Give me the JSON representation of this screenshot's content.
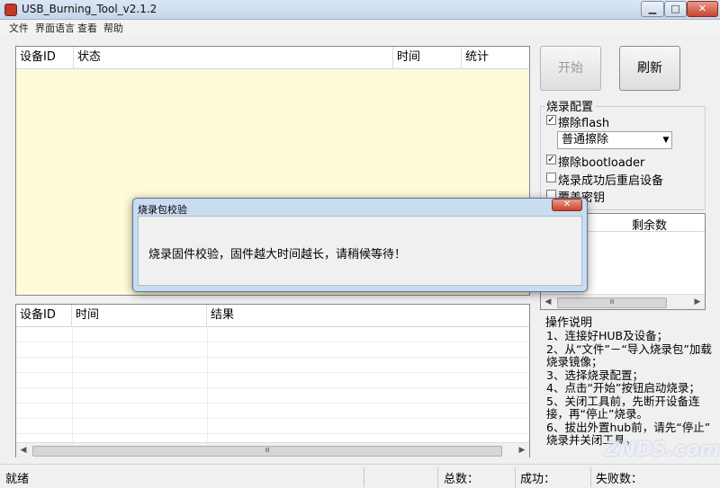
{
  "window": {
    "title": "USB_Burning_Tool_v2.1.2",
    "close_glyph": "✕"
  },
  "menu": {
    "items": [
      "文件",
      "界面语言",
      "查看",
      "帮助"
    ]
  },
  "top_table": {
    "headers": [
      "设备ID",
      "状态",
      "时间",
      "统计"
    ]
  },
  "buttons": {
    "start": "开始",
    "refresh": "刷新"
  },
  "config": {
    "title": "烧录配置",
    "erase_flash": "擦除flash",
    "erase_mode": "普通擦除",
    "erase_bootloader": "擦除bootloader",
    "reboot_after": "烧录成功后重启设备",
    "overwrite_key": "覆盖密钥"
  },
  "device_list": {
    "remaining_header": "剩余数"
  },
  "bottom_table": {
    "headers": [
      "设备ID",
      "时间",
      "结果"
    ]
  },
  "instructions": {
    "title": "操作说明",
    "lines": [
      "1、连接好HUB及设备；",
      "2、从“文件”－“导入烧录包”加载",
      "烧录镜像；",
      "3、选择烧录配置；",
      "4、点击“开始”按钮启动烧录；",
      "5、关闭工具前，先断开设备连",
      "接，再“停止”烧录。",
      "6、拔出外置hub前，请先“停止”",
      "烧录并关闭工具。"
    ]
  },
  "status_bar": {
    "ready": "就绪",
    "total": "总数：",
    "success": "成功：",
    "fail": "失败数："
  },
  "dialog": {
    "title": "烧录包校验",
    "message": "烧录固件校验，固件越大时间越长，请稍候等待！"
  },
  "watermark": "ZNDS.com",
  "icons": {
    "checkbox_checked": "✓",
    "dropdown": "▼",
    "scroll_left": "◀",
    "scroll_right": "▶",
    "scroll_grip": "Ⅲ"
  }
}
